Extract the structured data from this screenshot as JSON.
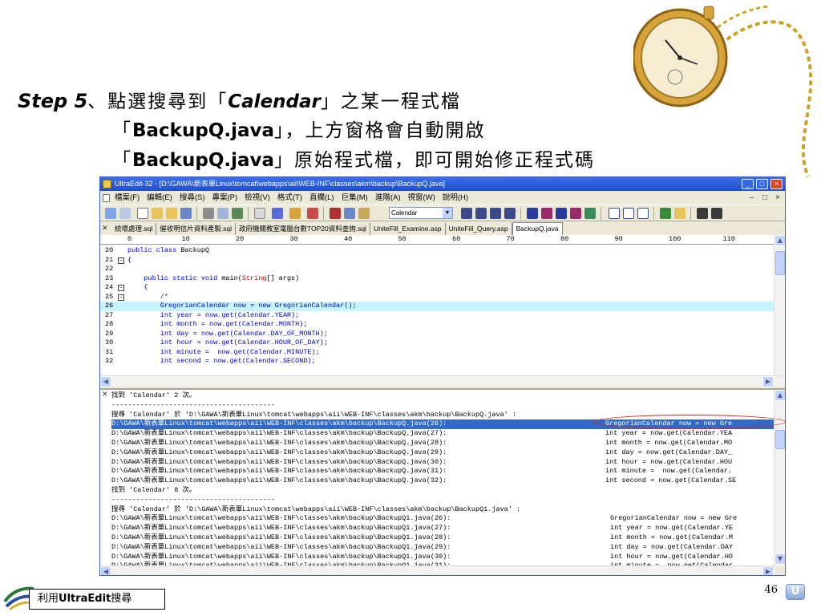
{
  "slide": {
    "step_label": "Step 5",
    "line1_pre": "、點選搜尋到「",
    "line1_kw": "Calendar",
    "line1_post": "」之某一程式檔",
    "line2_pre": "「",
    "line2_kw": "BackupQ.java",
    "line2_post": "」，上方窗格會自動開啟",
    "line3_pre": "「",
    "line3_kw": "BackupQ.java",
    "line3_post": "」原始程式檔，即可開始修正程式碼",
    "footer_pre": "利用",
    "footer_kw": "UltraEdit",
    "footer_post": "搜尋",
    "page_number": "46",
    "badge": "U"
  },
  "window": {
    "title": "UltraEdit-32 - [D:\\GAWA\\新表單Linux\\tomcat\\webapps\\aii\\WEB-INF\\classes\\akm\\backup\\BackupQ.java]",
    "controls": [
      "_",
      "□",
      "×"
    ],
    "mdi_controls": [
      "–",
      "□",
      "×"
    ],
    "menu": [
      "檔案(F)",
      "編輯(E)",
      "搜尋(S)",
      "專案(P)",
      "檢視(V)",
      "格式(T)",
      "直欄(L)",
      "巨集(M)",
      "進階(A)",
      "視窗(W)",
      "說明(H)"
    ],
    "font_combo": "Calendar",
    "tabs": [
      "統壞處理.sql",
      "催收明信片資料產製.sql",
      "政府機關教室電腦台數TOP20資料查詢.sql",
      "UniteFill_Examine.asp",
      "UniteFill_Query.asp",
      "BackupQ.java"
    ],
    "active_tab": 5,
    "ruler": [
      "0",
      "10",
      "20",
      "30",
      "40",
      "50",
      "60",
      "70",
      "80",
      "90",
      "100",
      "110",
      "12"
    ]
  },
  "code_lines": [
    {
      "n": "20",
      "fold": "",
      "kw": "public class ",
      "txt": "BackupQ",
      "typ": "",
      "rest": ""
    },
    {
      "n": "21",
      "fold": "-",
      "kw": "",
      "txt": "{",
      "typ": "",
      "rest": ""
    },
    {
      "n": "22",
      "fold": "",
      "kw": "",
      "txt": "",
      "typ": "",
      "rest": ""
    },
    {
      "n": "23",
      "fold": "",
      "kw": "    public static void ",
      "txt": "main(",
      "typ": "String",
      "rest": "[] args)"
    },
    {
      "n": "24",
      "fold": "-",
      "kw": "",
      "txt": "    {",
      "typ": "",
      "rest": ""
    },
    {
      "n": "25",
      "fold": "-",
      "kw": "",
      "txt": "        /*",
      "typ": "",
      "rest": ""
    },
    {
      "n": "26",
      "fold": "",
      "kw": "",
      "txt": "        GregorianCalendar now = new GregorianCalendar();",
      "typ": "",
      "rest": ""
    },
    {
      "n": "27",
      "fold": "",
      "kw": "",
      "txt": "        int year = now.get(Calendar.YEAR);",
      "typ": "",
      "rest": ""
    },
    {
      "n": "28",
      "fold": "",
      "kw": "",
      "txt": "        int month = now.get(Calendar.MONTH);",
      "typ": "",
      "rest": ""
    },
    {
      "n": "29",
      "fold": "",
      "kw": "",
      "txt": "        int day = now.get(Calendar.DAY_OF_MONTH);",
      "typ": "",
      "rest": ""
    },
    {
      "n": "30",
      "fold": "",
      "kw": "",
      "txt": "        int hour = now.get(Calendar.HOUR_OF_DAY);",
      "typ": "",
      "rest": ""
    },
    {
      "n": "31",
      "fold": "",
      "kw": "",
      "txt": "        int minute =  now.get(Calendar.MINUTE);",
      "typ": "",
      "rest": ""
    },
    {
      "n": "32",
      "fold": "",
      "kw": "",
      "txt": "        int second = now.get(Calendar.SECOND);",
      "typ": "",
      "rest": ""
    }
  ],
  "highlight_line": 6,
  "output_lines": [
    {
      "path": "找到 'Calendar' 2 次。",
      "snip": "",
      "sel": false,
      "q1": false
    },
    {
      "path": "----------------------------------------",
      "snip": "",
      "sel": false,
      "q1": false
    },
    {
      "path": "搜尋 'Calendar' 於 'D:\\GAWA\\新表單Linux\\tomcat\\webapps\\aii\\WEB-INF\\classes\\akm\\backup\\BackupQ.java' :",
      "snip": "",
      "sel": false,
      "q1": false
    },
    {
      "path": "D:\\GAWA\\新表單Linux\\tomcat\\webapps\\aii\\WEB-INF\\classes\\akm\\backup\\BackupQ.java(26):",
      "snip": "GregorianCalendar now = new Gre",
      "sel": true,
      "q1": false
    },
    {
      "path": "D:\\GAWA\\新表單Linux\\tomcat\\webapps\\aii\\WEB-INF\\classes\\akm\\backup\\BackupQ.java(27):",
      "snip": "int year = now.get(Calendar.YEA",
      "sel": false,
      "q1": false
    },
    {
      "path": "D:\\GAWA\\新表單Linux\\tomcat\\webapps\\aii\\WEB-INF\\classes\\akm\\backup\\BackupQ.java(28):",
      "snip": "int month = now.get(Calendar.MO",
      "sel": false,
      "q1": false
    },
    {
      "path": "D:\\GAWA\\新表單Linux\\tomcat\\webapps\\aii\\WEB-INF\\classes\\akm\\backup\\BackupQ.java(29):",
      "snip": "int day = now.get(Calendar.DAY_",
      "sel": false,
      "q1": false
    },
    {
      "path": "D:\\GAWA\\新表單Linux\\tomcat\\webapps\\aii\\WEB-INF\\classes\\akm\\backup\\BackupQ.java(30):",
      "snip": "int hour = now.get(Calendar.HOU",
      "sel": false,
      "q1": false
    },
    {
      "path": "D:\\GAWA\\新表單Linux\\tomcat\\webapps\\aii\\WEB-INF\\classes\\akm\\backup\\BackupQ.java(31):",
      "snip": "int minute =  now.get(Calendar.",
      "sel": false,
      "q1": false
    },
    {
      "path": "D:\\GAWA\\新表單Linux\\tomcat\\webapps\\aii\\WEB-INF\\classes\\akm\\backup\\BackupQ.java(32):",
      "snip": "int second = now.get(Calendar.SE",
      "sel": false,
      "q1": false
    },
    {
      "path": "找到 'Calendar' 8 次。",
      "snip": "",
      "sel": false,
      "q1": false
    },
    {
      "path": "----------------------------------------",
      "snip": "",
      "sel": false,
      "q1": false
    },
    {
      "path": "搜尋 'Calendar' 於 'D:\\GAWA\\新表單Linux\\tomcat\\webapps\\aii\\WEB-INF\\classes\\akm\\backup\\BackupQ1.java' :",
      "snip": "",
      "sel": false,
      "q1": false
    },
    {
      "path": "D:\\GAWA\\新表單Linux\\tomcat\\webapps\\aii\\WEB-INF\\classes\\akm\\backup\\BackupQ1.java(26):",
      "snip": "GregorianCalendar now = new Gre",
      "sel": false,
      "q1": true
    },
    {
      "path": "D:\\GAWA\\新表單Linux\\tomcat\\webapps\\aii\\WEB-INF\\classes\\akm\\backup\\BackupQ1.java(27):",
      "snip": "int year = now.get(Calendar.YE",
      "sel": false,
      "q1": true
    },
    {
      "path": "D:\\GAWA\\新表單Linux\\tomcat\\webapps\\aii\\WEB-INF\\classes\\akm\\backup\\BackupQ1.java(28):",
      "snip": "int month = now.get(Calendar.M",
      "sel": false,
      "q1": true
    },
    {
      "path": "D:\\GAWA\\新表單Linux\\tomcat\\webapps\\aii\\WEB-INF\\classes\\akm\\backup\\BackupQ1.java(29):",
      "snip": "int day = now.get(Calendar.DAY",
      "sel": false,
      "q1": true
    },
    {
      "path": "D:\\GAWA\\新表單Linux\\tomcat\\webapps\\aii\\WEB-INF\\classes\\akm\\backup\\BackupQ1.java(30):",
      "snip": "int hour = now.get(Calendar.HO",
      "sel": false,
      "q1": true
    },
    {
      "path": "D:\\GAWA\\新表單Linux\\tomcat\\webapps\\aii\\WEB-INF\\classes\\akm\\backup\\BackupQ1.java(31):",
      "snip": "int minute =  now.get(Calendar",
      "sel": false,
      "q1": true
    }
  ],
  "colors": {
    "title_bar": "#1f4fc8",
    "highlight": "#c8f4ff",
    "selection": "#3169c6",
    "keyword": "#0000ff",
    "type": "#c80000",
    "annotation": "#e02020"
  },
  "icons": [
    "pocket-watch-icon",
    "app-icon",
    "new-file-icon",
    "open-icon",
    "save-icon",
    "print-icon",
    "find-icon",
    "close-icon",
    "scroll-up-icon",
    "scroll-down-icon",
    "ultraedit-logo-icon"
  ]
}
